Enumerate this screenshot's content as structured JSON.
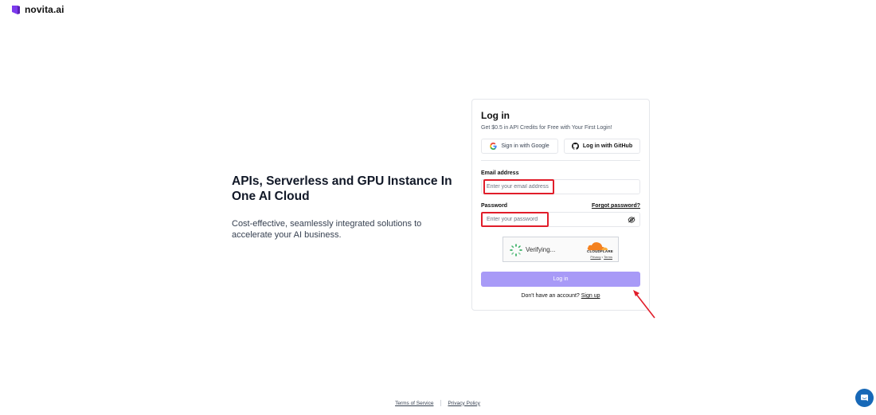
{
  "brand": {
    "name": "novita.ai",
    "color": "#7c3aed",
    "icon": "novita-logo-icon"
  },
  "hero": {
    "title": "APIs, Serverless and GPU Instance In One AI Cloud",
    "subtitle": "Cost-effective, seamlessly integrated solutions to accelerate your AI business."
  },
  "login": {
    "title": "Log in",
    "subtitle": "Get $0.5 in API Credits for Free with Your First Login!",
    "google_label": "Sign in with Google",
    "github_label": "Log in with GitHub",
    "email_label": "Email address",
    "email_placeholder": "Enter your email address",
    "password_label": "Password",
    "forgot_label": "Forgot password?",
    "password_placeholder": "Enter your password",
    "submit_label": "Log in",
    "submit_color": "#a89af7",
    "no_account_text": "Don't have an account?",
    "signup_label": "Sign up"
  },
  "captcha": {
    "status": "Verifying...",
    "provider": "CLOUDFLARE",
    "privacy_label": "Privacy",
    "separator": "•",
    "terms_label": "Terms"
  },
  "annotation": {
    "highlight_color": "#e11d2a"
  },
  "footer": {
    "terms_label": "Terms of Service",
    "privacy_label": "Privacy Policy"
  },
  "chat": {
    "icon": "chat-bubble-icon",
    "color": "#1768b7"
  }
}
